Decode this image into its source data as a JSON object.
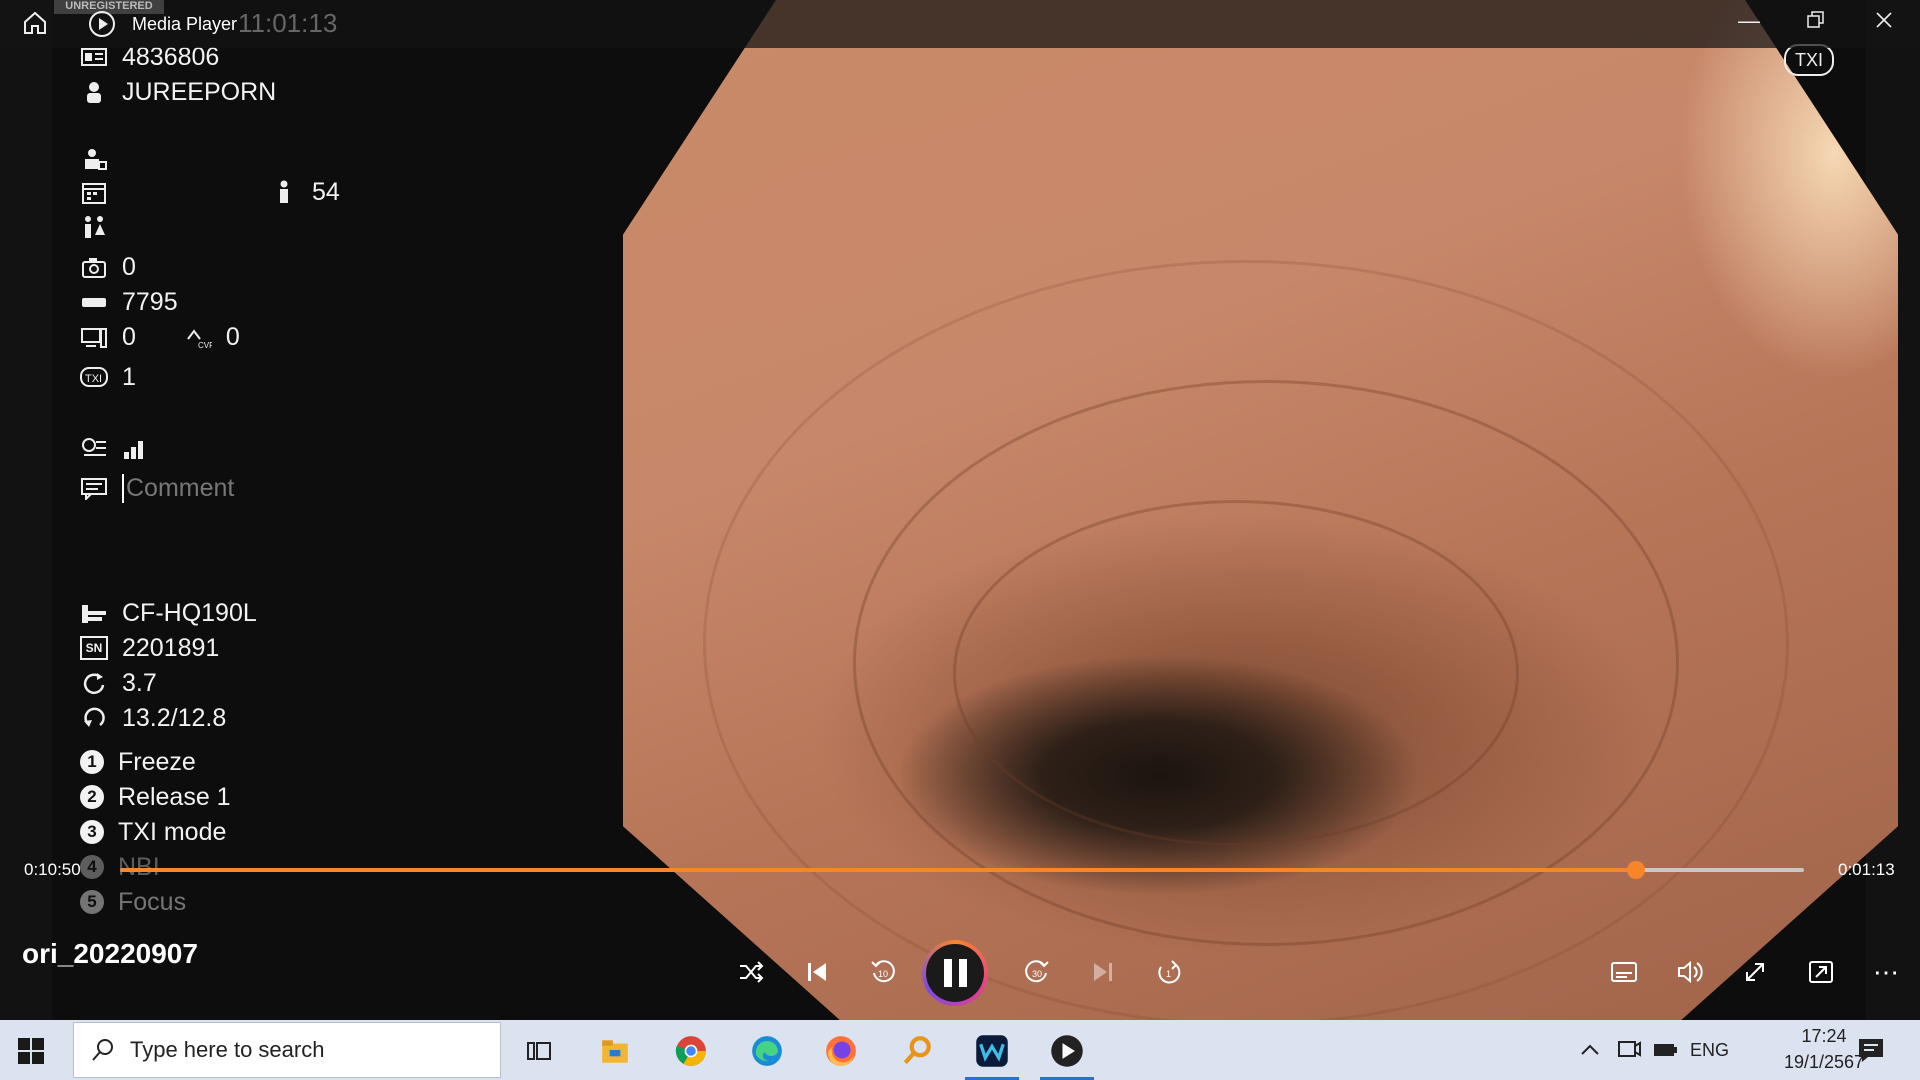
{
  "window": {
    "title": "Media Player",
    "watermark_label": "UNREGISTERED",
    "timestamp_overlay": "11:01:13",
    "home_icon": "home-icon",
    "buttons": {
      "minimize": "minimize-icon",
      "restore": "restore-icon",
      "close": "close-icon"
    }
  },
  "video_overlay": {
    "patient_id": "4836806",
    "patient_name": "JUREEPORN",
    "age": "54",
    "camera_count": "0",
    "counter": "7795",
    "monitor_value": "0",
    "cvp_value": "0",
    "txi_value": "1",
    "comment_placeholder": "Comment",
    "scope_model": "CF-HQ190L",
    "serial_label": "SN",
    "serial": "2201891",
    "value_a": "3.7",
    "value_b": "13.2/12.8",
    "txi_badge": "TXI",
    "functions": [
      {
        "n": "1",
        "label": "Freeze"
      },
      {
        "n": "2",
        "label": "Release 1"
      },
      {
        "n": "3",
        "label": "TXI mode"
      },
      {
        "n": "4",
        "label": "NBI"
      },
      {
        "n": "5",
        "label": "Focus"
      }
    ]
  },
  "player": {
    "elapsed": "0:10:50",
    "remaining": "0:01:13",
    "progress_fraction": 0.9,
    "file_name": "ori_20220907",
    "accent_color": "#f7862a"
  },
  "taskbar": {
    "search_placeholder": "Type here to search",
    "language": "ENG",
    "time": "17:24",
    "date": "19/1/2567"
  }
}
